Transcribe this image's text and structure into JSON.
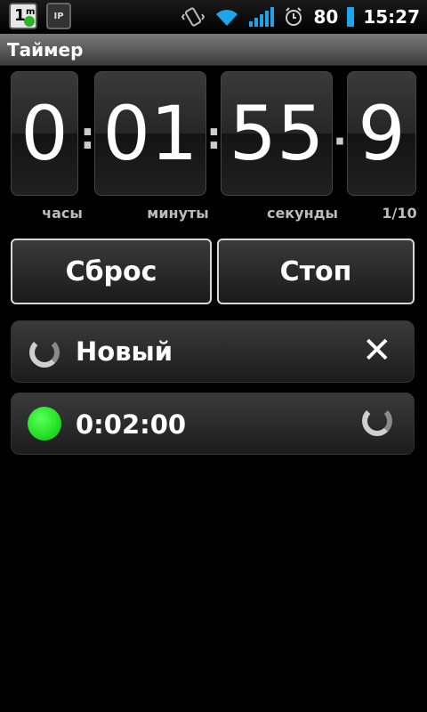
{
  "status_bar": {
    "badge1_digit": "1",
    "badge1_sub": "m",
    "badge2_label": "IP",
    "battery_level": "80",
    "time": "15:27"
  },
  "title": "Таймер",
  "timer": {
    "hours": "0",
    "minutes": "01",
    "seconds": "55",
    "tenths": "9",
    "labels": {
      "hours": "часы",
      "minutes": "минуты",
      "seconds": "секунды",
      "tenths": "1/10"
    }
  },
  "buttons": {
    "reset": "Сброс",
    "stop": "Стоп"
  },
  "timers_list": [
    {
      "label": "Новый",
      "state": "loading"
    },
    {
      "label": "0:02:00",
      "state": "active"
    }
  ],
  "colors": {
    "accent": "#1EA5E9",
    "active_indicator": "#22E022"
  }
}
